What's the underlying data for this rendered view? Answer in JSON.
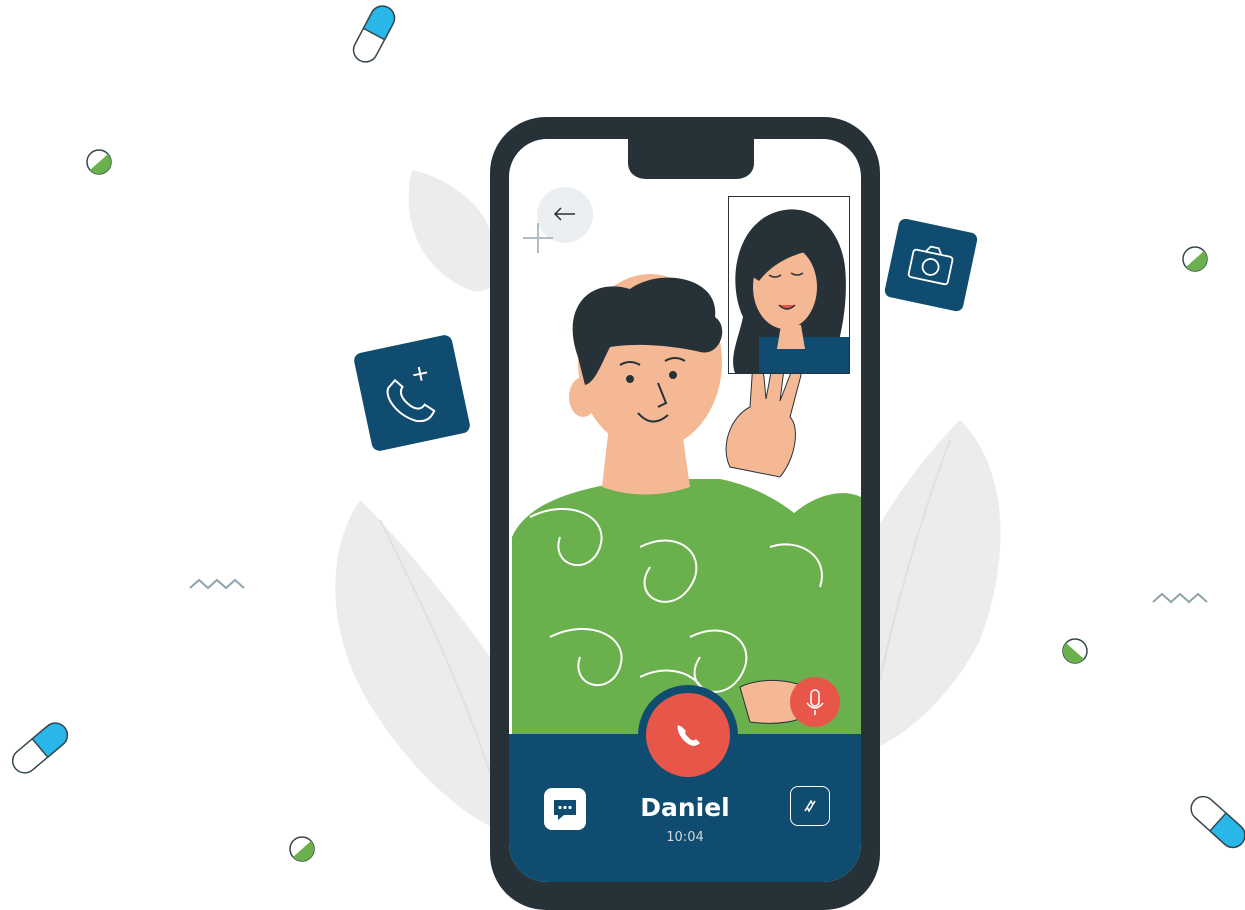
{
  "call": {
    "caller_name": "Daniel",
    "duration": "10:04"
  },
  "colors": {
    "phone_frame": "#263238",
    "call_bar": "#0f4c6f",
    "end_call": "#e8564a",
    "sweater": "#6ab04c",
    "pill_blue": "#29b6e8",
    "pill_green": "#6ab04c",
    "leaf": "#ececec"
  },
  "icons": {
    "back": "back-arrow-icon",
    "end_call": "end-call-icon",
    "mic": "microphone-icon",
    "chat": "chat-icon",
    "switch_camera": "switch-camera-icon",
    "add_call": "add-call-icon",
    "camera": "camera-icon"
  }
}
